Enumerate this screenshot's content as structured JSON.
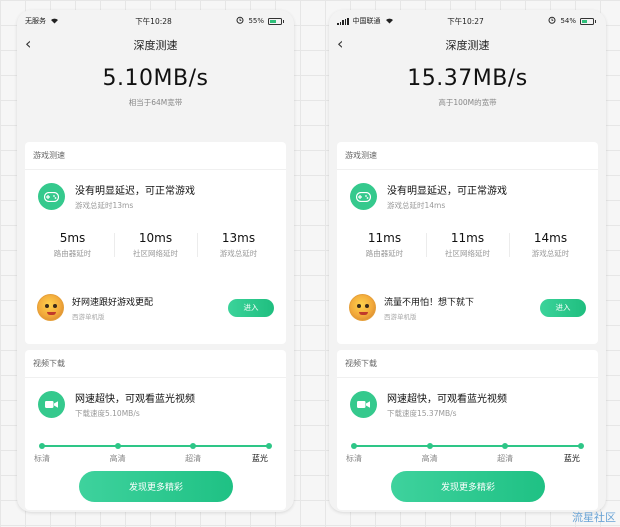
{
  "colors": {
    "accent": "#2ec687",
    "button_gradient_start": "#3ed29d",
    "button_gradient_end": "#1fc184"
  },
  "screens": [
    {
      "status_bar": {
        "carrier": "无服务",
        "time": "下午10:28",
        "battery": "55%",
        "battery_level": 0.55
      },
      "nav": {
        "title": "深度测速",
        "back_icon": "chevron-left-icon"
      },
      "speed": {
        "value": "5.10MB/s",
        "sub": "相当于64M宽带"
      },
      "game": {
        "header": "游戏测速",
        "status_title": "没有明显延迟，可正常游戏",
        "status_sub": "游戏总延时13ms",
        "stats": [
          {
            "value": "5ms",
            "label": "路由器延时"
          },
          {
            "value": "10ms",
            "label": "社区网络延时"
          },
          {
            "value": "13ms",
            "label": "游戏总延时"
          }
        ],
        "promo_title": "好网速跟好游戏更配",
        "promo_sub": "西游单机版",
        "enter_label": "进入"
      },
      "video": {
        "header": "视频下载",
        "status_title": "网速超快，可观看蓝光视频",
        "status_sub": "下载速度5.10MB/s",
        "qualities": [
          "标清",
          "高清",
          "超清",
          "蓝光"
        ],
        "active_index": 3
      },
      "cta": "发现更多精彩"
    },
    {
      "status_bar": {
        "carrier": "中国联通",
        "time": "下午10:27",
        "battery": "54%",
        "battery_level": 0.54
      },
      "nav": {
        "title": "深度测速",
        "back_icon": "chevron-left-icon"
      },
      "speed": {
        "value": "15.37MB/s",
        "sub": "高于100M的宽带"
      },
      "game": {
        "header": "游戏测速",
        "status_title": "没有明显延迟，可正常游戏",
        "status_sub": "游戏总延时14ms",
        "stats": [
          {
            "value": "11ms",
            "label": "路由器延时"
          },
          {
            "value": "11ms",
            "label": "社区网络延时"
          },
          {
            "value": "14ms",
            "label": "游戏总延时"
          }
        ],
        "promo_title": "流量不用怕！想下就下",
        "promo_sub": "西游单机版",
        "enter_label": "进入"
      },
      "video": {
        "header": "视频下载",
        "status_title": "网速超快，可观看蓝光视频",
        "status_sub": "下载速度15.37MB/s",
        "qualities": [
          "标清",
          "高清",
          "超清",
          "蓝光"
        ],
        "active_index": 3
      },
      "cta": "发现更多精彩"
    }
  ],
  "watermark": "流星社区"
}
